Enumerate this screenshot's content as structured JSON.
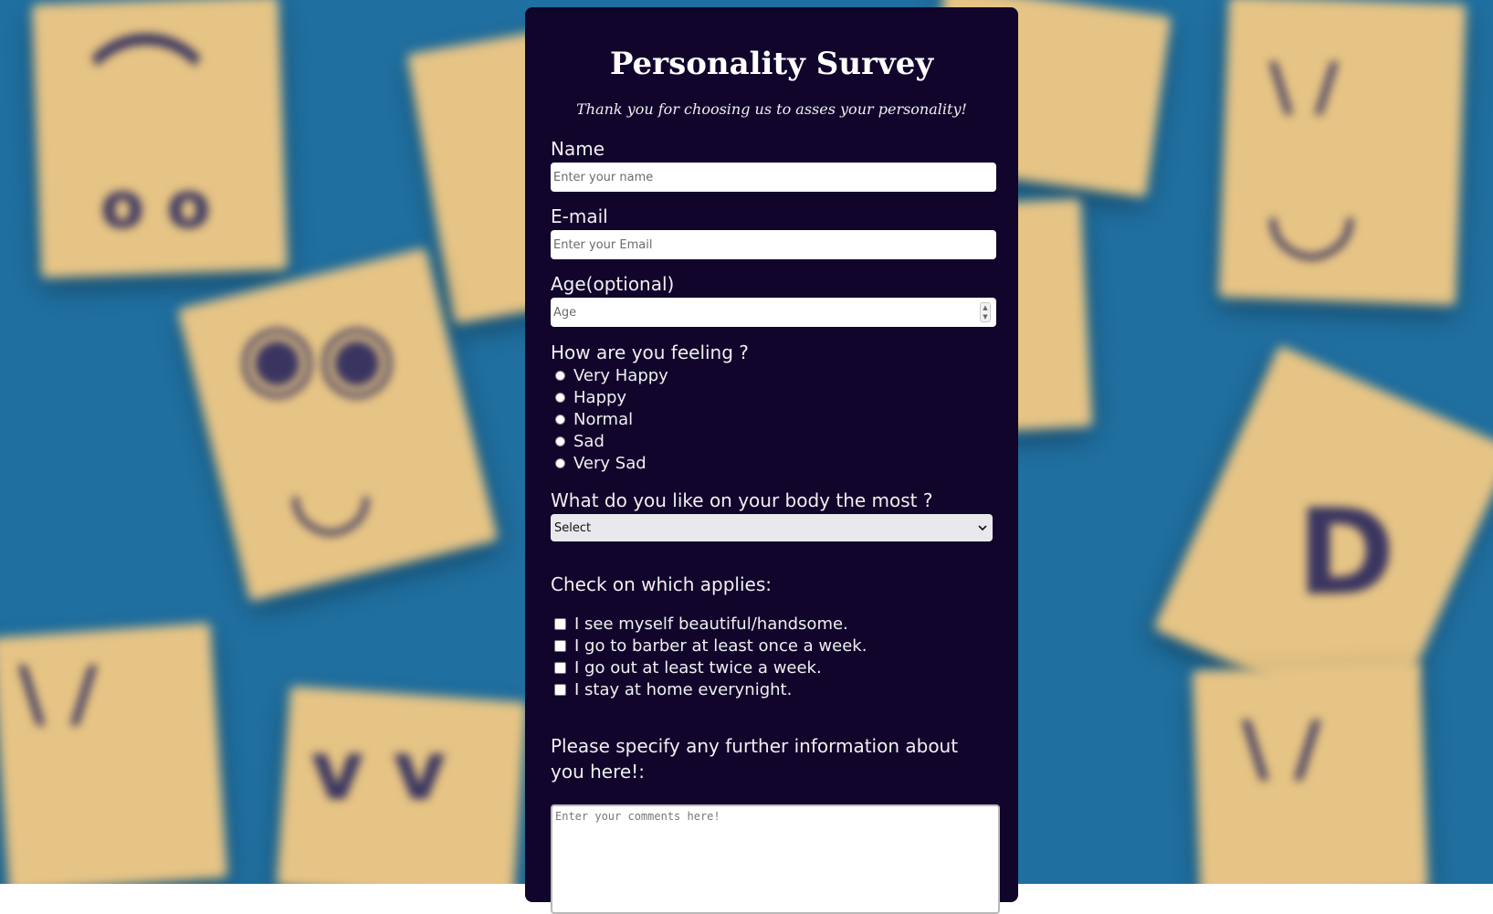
{
  "survey": {
    "title": "Personality Survey",
    "subtitle": "Thank you for choosing us to asses your personality!",
    "name": {
      "label": "Name",
      "placeholder": "Enter your name"
    },
    "email": {
      "label": "E-mail",
      "placeholder": "Enter your Email"
    },
    "age": {
      "label": "Age(optional)",
      "placeholder": "Age"
    },
    "feeling": {
      "label": "How are you feeling ?",
      "options": [
        "Very Happy",
        "Happy",
        "Normal",
        "Sad",
        "Very Sad"
      ]
    },
    "body": {
      "label": "What do you like on your body the most ?",
      "selected": "Select"
    },
    "applies": {
      "label": "Check on which applies:",
      "options": [
        "I see myself beautiful/handsome.",
        "I go to barber at least once a week.",
        "I go out at least twice a week.",
        "I stay at home everynight."
      ]
    },
    "comments": {
      "label": "Please specify any further information about you here!:",
      "placeholder": "Enter your comments here!"
    }
  },
  "colors": {
    "panel": "#11052c",
    "background": "#1f6fa0",
    "tile": "#e6c485"
  },
  "icons": {
    "select_arrow": "chevron-down-icon",
    "number_spinner": "spinner-icon"
  }
}
